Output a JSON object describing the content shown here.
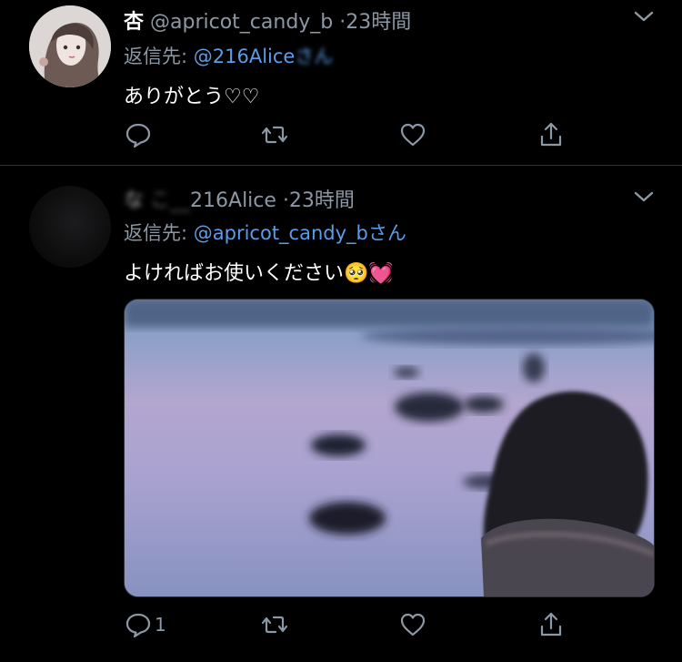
{
  "tweets": [
    {
      "display_name": "杏",
      "handle": "@apricot_candy_b",
      "time": "·23時間",
      "reply_prefix": "返信先: ",
      "reply_mention": "@216Alice",
      "reply_suffix": "さん",
      "text": "ありがとう♡♡",
      "actions": {
        "reply_count": "",
        "retweet_count": "",
        "like_count": ""
      }
    },
    {
      "display_name": "な",
      "handle": "216Alice",
      "time": "·23時間",
      "reply_prefix": "返信先: ",
      "reply_mention": "@apricot_candy_bさん",
      "text": "よければお使いください",
      "emoji": "🥺💓",
      "media_alt": "blurred lakeside photo",
      "actions": {
        "reply_count": "1",
        "retweet_count": "",
        "like_count": ""
      }
    }
  ],
  "icons": [
    "reply-icon",
    "retweet-icon",
    "like-icon",
    "share-icon",
    "chevron-down-icon"
  ],
  "colors": {
    "background": "#000000",
    "link": "#5b9de8",
    "muted": "#8b98a5",
    "divider": "#2f3336"
  }
}
